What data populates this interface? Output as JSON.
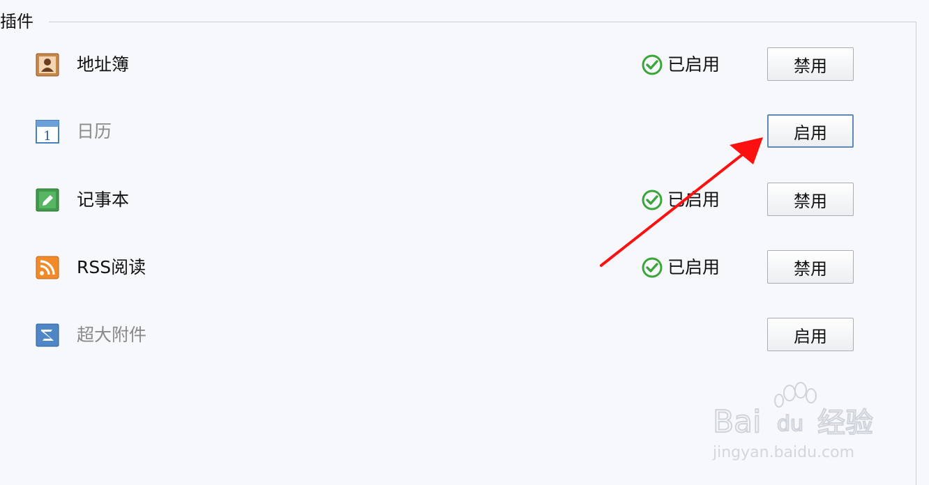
{
  "section": {
    "legend": "插件"
  },
  "plugins": [
    {
      "name": "地址簿",
      "icon": "address-book-icon",
      "enabled": true,
      "status_label": "已启用",
      "action_label": "禁用"
    },
    {
      "name": "日历",
      "icon": "calendar-icon",
      "enabled": false,
      "status_label": "",
      "action_label": "启用",
      "icon_digit": "1"
    },
    {
      "name": "记事本",
      "icon": "notepad-icon",
      "enabled": true,
      "status_label": "已启用",
      "action_label": "禁用"
    },
    {
      "name": "RSS阅读",
      "icon": "rss-icon",
      "enabled": true,
      "status_label": "已启用",
      "action_label": "禁用"
    },
    {
      "name": "超大附件",
      "icon": "large-attachment-icon",
      "enabled": false,
      "status_label": "",
      "action_label": "启用"
    }
  ],
  "watermark": {
    "brand_a": "Bai",
    "brand_b": "du",
    "brand_c": "经验",
    "url": "jingyan.baidu.com"
  },
  "colors": {
    "status_green": "#3aa53a",
    "disabled_text": "#8a8a8a",
    "focus_border": "#5f87b7",
    "annotation_arrow": "#ff1010"
  }
}
